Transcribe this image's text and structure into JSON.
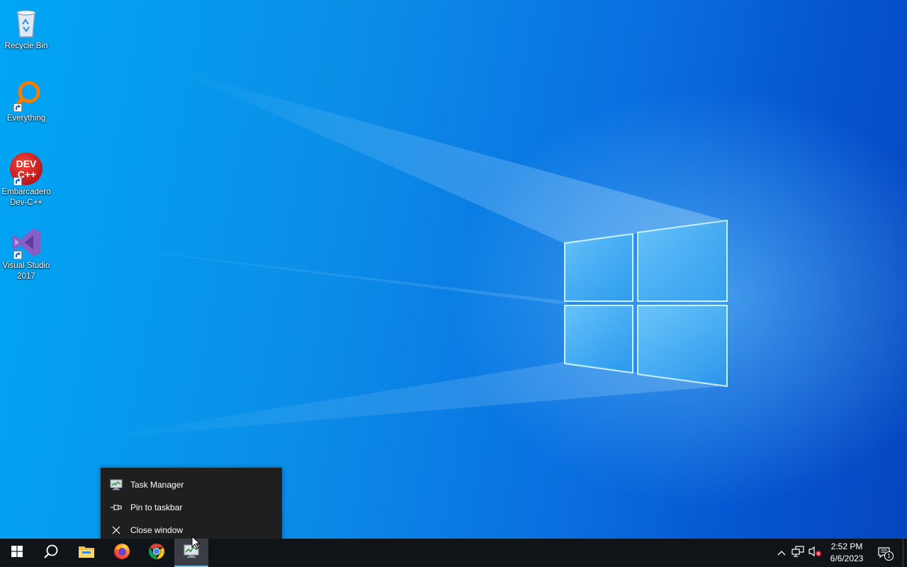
{
  "desktop": {
    "icons": [
      {
        "label": "Recycle Bin",
        "icon": "recycle-bin-icon"
      },
      {
        "label": "Everything",
        "icon": "everything-search-icon"
      },
      {
        "label": "Embarcadero\nDev-C++",
        "label_line1": "Embarcadero",
        "label_line2": "Dev-C++",
        "icon": "dev-cpp-icon",
        "logo_text_1": "DEV",
        "logo_text_2": "C++"
      },
      {
        "label": "Visual Studio 2017",
        "label_line1": "Visual Studio",
        "label_line2": "2017",
        "icon": "visual-studio-icon"
      }
    ]
  },
  "context_menu": {
    "items": [
      {
        "label": "Task Manager",
        "icon": "task-manager-icon"
      },
      {
        "label": "Pin to taskbar",
        "icon": "pin-icon"
      },
      {
        "label": "Close window",
        "icon": "close-icon"
      }
    ]
  },
  "taskbar": {
    "buttons": [
      {
        "name": "start",
        "icon": "windows-start-icon"
      },
      {
        "name": "search",
        "icon": "search-icon"
      },
      {
        "name": "file-explorer",
        "icon": "folder-icon"
      },
      {
        "name": "firefox",
        "icon": "firefox-icon"
      },
      {
        "name": "chrome",
        "icon": "chrome-icon"
      },
      {
        "name": "task-manager",
        "icon": "task-manager-icon",
        "active": true
      }
    ],
    "tray": {
      "icons": [
        "chevron-up-icon",
        "network-icon",
        "volume-muted-icon"
      ],
      "time": "2:52 PM",
      "date": "6/6/2023",
      "notification_count": "1"
    }
  },
  "colors": {
    "taskbar_bg": "#101318",
    "menu_bg": "#1f1f1f",
    "accent": "#76b9ed"
  }
}
